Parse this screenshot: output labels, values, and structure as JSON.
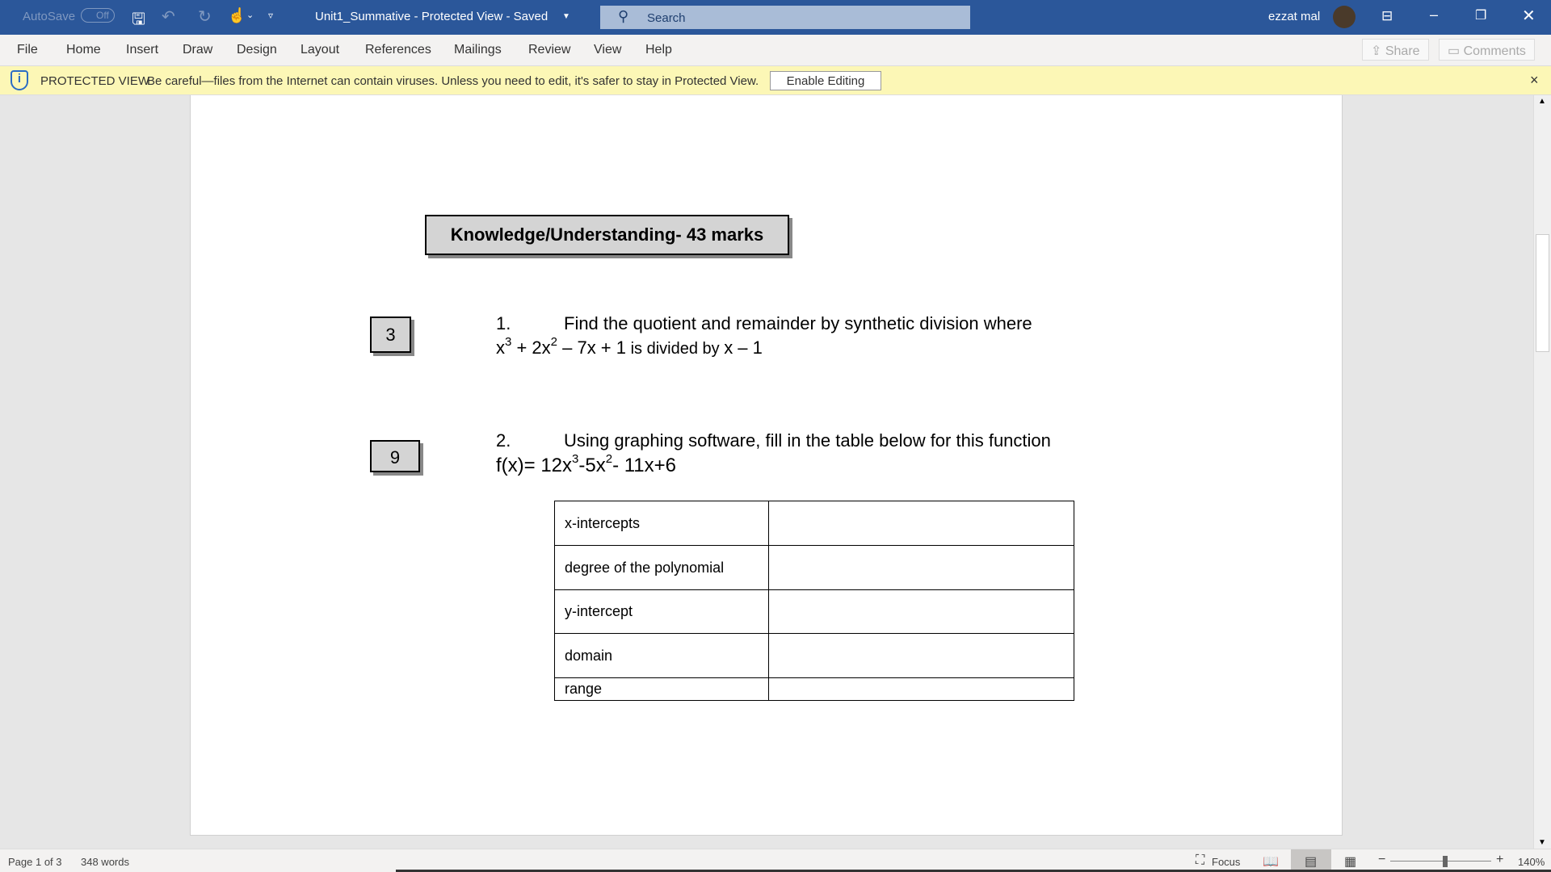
{
  "titlebar": {
    "autosave": "AutoSave",
    "autosave_state": "Off",
    "doc_title": "Unit1_Summative  -  Protected View  -  Saved",
    "search_placeholder": "Search",
    "user": "ezzat mal",
    "accent": "#2b579a"
  },
  "ribbon": {
    "tabs": [
      "File",
      "Home",
      "Insert",
      "Draw",
      "Design",
      "Layout",
      "References",
      "Mailings",
      "Review",
      "View",
      "Help"
    ],
    "share": "Share",
    "comments": "Comments"
  },
  "protected": {
    "label": "PROTECTED VIEW",
    "message": "Be careful—files from the Internet can contain viruses. Unless you need to edit, it's safer to stay in Protected View.",
    "button": "Enable Editing",
    "close": "×"
  },
  "doc": {
    "heading": "Knowledge/Understanding- 43 marks",
    "q1": {
      "marks": "3",
      "num": "1.",
      "text": "Find the quotient and remainder by synthetic division where",
      "expr_a": "x",
      "exp1": "3",
      "expr_b": " + 2x",
      "exp2": "2",
      "expr_c": " – 7x + 1",
      "mid": " is divided by ",
      "expr_d": "x – 1"
    },
    "q2": {
      "marks": "9",
      "num": "2.",
      "text": "Using graphing software, fill in the table below for this function",
      "f_a": "f(x)= 12x",
      "exp1": "3",
      "f_b": "-5x",
      "exp2": "2",
      "f_c": "- 11x+6"
    },
    "table": [
      [
        "x-intercepts",
        ""
      ],
      [
        "degree of the polynomial",
        ""
      ],
      [
        "y-intercept",
        ""
      ],
      [
        "domain",
        ""
      ],
      [
        "range",
        ""
      ]
    ]
  },
  "status": {
    "page": "Page 1 of 3",
    "words": "348 words",
    "focus": "Focus",
    "zoom": "140%",
    "zoom_level": 140
  }
}
